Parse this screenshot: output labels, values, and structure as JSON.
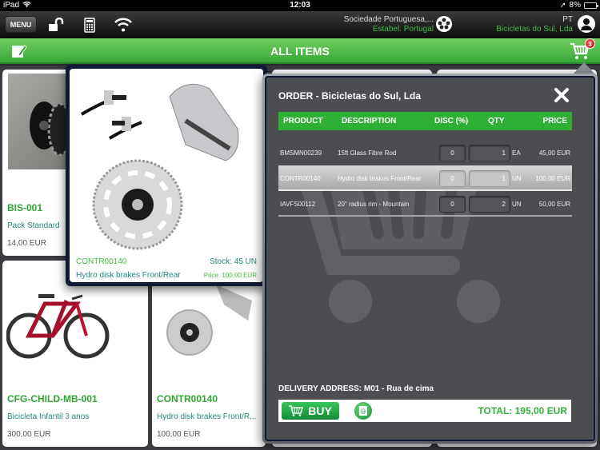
{
  "status_bar": {
    "device": "iPad",
    "time": "12:03",
    "battery": "8%"
  },
  "toolbar": {
    "menu_label": "MENU",
    "company_name": "Sociedade Portuguesa,...",
    "company_branch": "Estabel. Portugal",
    "client_code": "PT",
    "client_name": "Bicicletas do Sul, Lda"
  },
  "titlebar": {
    "title": "ALL ITEMS",
    "cart_count": "3"
  },
  "products": [
    {
      "code": "BIS-001",
      "description": "Pack Standard",
      "price": "14,00 EUR"
    },
    {
      "code": "CFG-CHILD-MB-001",
      "description": "Bicicleta Infantil 3 anos",
      "price": "300,00 EUR"
    },
    {
      "code": "CONTR00140",
      "description": "Hydro disk brakes Front/R...",
      "price": "100,00 EUR"
    }
  ],
  "product_detail": {
    "code": "CONTR00140",
    "stock": "Stock: 45 UN",
    "description": "Hydro disk brakes Front/Rear",
    "price": "Price: 100,00 EUR"
  },
  "order": {
    "title": "ORDER - Bicicletas do Sul, Lda",
    "columns": [
      "PRODUCT",
      "DESCRIPTION",
      "DISC (%)",
      "QTY",
      "PRICE"
    ],
    "rows": [
      {
        "product": "BMSMN00239",
        "description": "15ft Glass Fibre Rod",
        "disc": "0",
        "qty": "1",
        "unit": "EA",
        "price": "45,00 EUR",
        "selected": false
      },
      {
        "product": "CONTR00140",
        "description": "Hydro disk brakes Front/Rear",
        "disc": "0",
        "qty": "1",
        "unit": "UN",
        "price": "100,00 EUR",
        "selected": true
      },
      {
        "product": "IAVFS00112",
        "description": "20'' radius rim - Mountain",
        "disc": "0",
        "qty": "2",
        "unit": "UN",
        "price": "50,00 EUR",
        "selected": false
      }
    ],
    "delivery_address": "DELIVERY ADDRESS: M01 - Rua de cima",
    "buy_label": "BUY",
    "total": "TOTAL: 195,00 EUR"
  },
  "colors": {
    "accent_green": "#2fb034",
    "text_green": "#3fbf3f",
    "teal_text": "#23887a",
    "badge_red": "#d00000"
  }
}
